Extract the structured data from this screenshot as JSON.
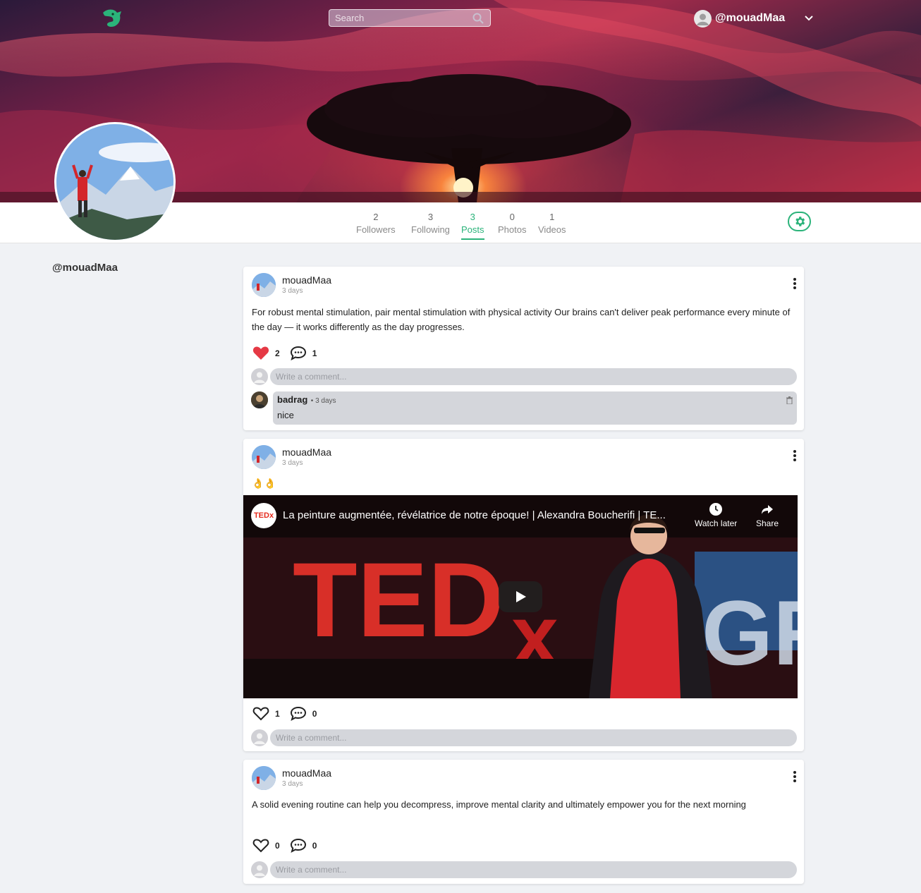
{
  "header": {
    "search_placeholder": "Search",
    "username": "@mouadMaa"
  },
  "profile": {
    "handle": "@mouadMaa",
    "stats": [
      {
        "num": "2",
        "label": "Followers"
      },
      {
        "num": "3",
        "label": "Following"
      },
      {
        "num": "3",
        "label": "Posts"
      },
      {
        "num": "0",
        "label": "Photos"
      },
      {
        "num": "1",
        "label": "Videos"
      }
    ],
    "active_stat": "Posts"
  },
  "comment_placeholder": "Write a comment...",
  "posts": [
    {
      "author": "mouadMaa",
      "time": "3 days",
      "text": "For robust mental stimulation, pair mental stimulation with physical activity Our brains can't deliver peak performance every minute of the day — it works differently as the day progresses.",
      "likes": "2",
      "comments": "1",
      "liked": true,
      "replies": [
        {
          "author": "badrag",
          "time": "• 3 days",
          "text": "nice"
        }
      ]
    },
    {
      "author": "mouadMaa",
      "time": "3 days",
      "text": "👌👌",
      "likes": "1",
      "comments": "0",
      "liked": false,
      "video": {
        "title": "La peinture augmentée, révélatrice de notre époque! | Alexandra Boucherifi | TE...",
        "channel_logo": "TEDx",
        "watch_later": "Watch later",
        "share": "Share"
      }
    },
    {
      "author": "mouadMaa",
      "time": "3 days",
      "text": "A solid evening routine can help you decompress, improve mental clarity and ultimately empower you for the next morning",
      "likes": "0",
      "comments": "0",
      "liked": false
    }
  ],
  "colors": {
    "accent": "#2bb37a",
    "like": "#e53945"
  }
}
